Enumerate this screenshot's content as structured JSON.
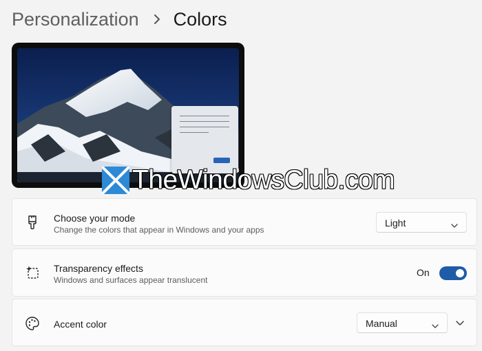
{
  "breadcrumb": {
    "parent": "Personalization",
    "separator_icon": "chevron-right-icon",
    "current": "Colors"
  },
  "preview": {
    "wallpaper": "snow-capped mountain at dusk",
    "window_accent": "#2764b6"
  },
  "watermark": {
    "text": "TheWindowsClub.com"
  },
  "settings": {
    "mode": {
      "icon": "brush-icon",
      "title": "Choose your mode",
      "description": "Change the colors that appear in Windows and your apps",
      "value": "Light"
    },
    "transparency": {
      "icon": "transparency-icon",
      "title": "Transparency effects",
      "description": "Windows and surfaces appear translucent",
      "state_label": "On",
      "enabled": true
    },
    "accent": {
      "icon": "palette-icon",
      "title": "Accent color",
      "value": "Manual"
    }
  },
  "colors": {
    "background": "#f3f3f3",
    "card": "#fbfbfb",
    "toggle_on": "#1e5ca8",
    "text_secondary": "#5d5d5d"
  }
}
